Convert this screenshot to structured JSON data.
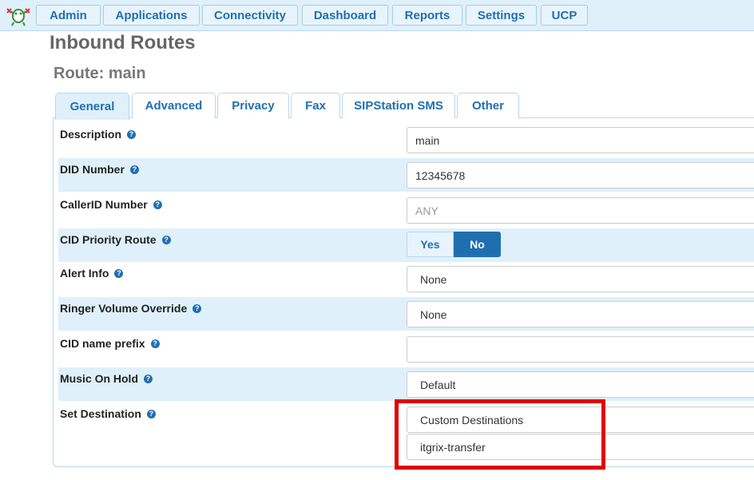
{
  "nav": {
    "items": [
      "Admin",
      "Applications",
      "Connectivity",
      "Dashboard",
      "Reports",
      "Settings",
      "UCP"
    ]
  },
  "page": {
    "title": "Inbound Routes",
    "route_title": "Route: main"
  },
  "tabs": [
    "General",
    "Advanced",
    "Privacy",
    "Fax",
    "SIPStation SMS",
    "Other"
  ],
  "active_tab": "General",
  "form": {
    "description": {
      "label": "Description",
      "value": "main"
    },
    "did_number": {
      "label": "DID Number",
      "value": "12345678"
    },
    "callerid_number": {
      "label": "CallerID Number",
      "placeholder": "ANY"
    },
    "cid_priority_route": {
      "label": "CID Priority Route",
      "yes": "Yes",
      "no": "No",
      "selected": "No"
    },
    "alert_info": {
      "label": "Alert Info",
      "value": "None"
    },
    "ringer_volume_override": {
      "label": "Ringer Volume Override",
      "value": "None"
    },
    "cid_name_prefix": {
      "label": "CID name prefix",
      "value": ""
    },
    "music_on_hold": {
      "label": "Music On Hold",
      "value": "Default"
    },
    "set_destination": {
      "label": "Set Destination",
      "category": "Custom Destinations",
      "target": "itgrix-transfer"
    }
  },
  "help_glyph": "?",
  "colors": {
    "accent": "#1f6fb0",
    "nav_bg": "#dff0fb",
    "highlight": "#e00000"
  }
}
